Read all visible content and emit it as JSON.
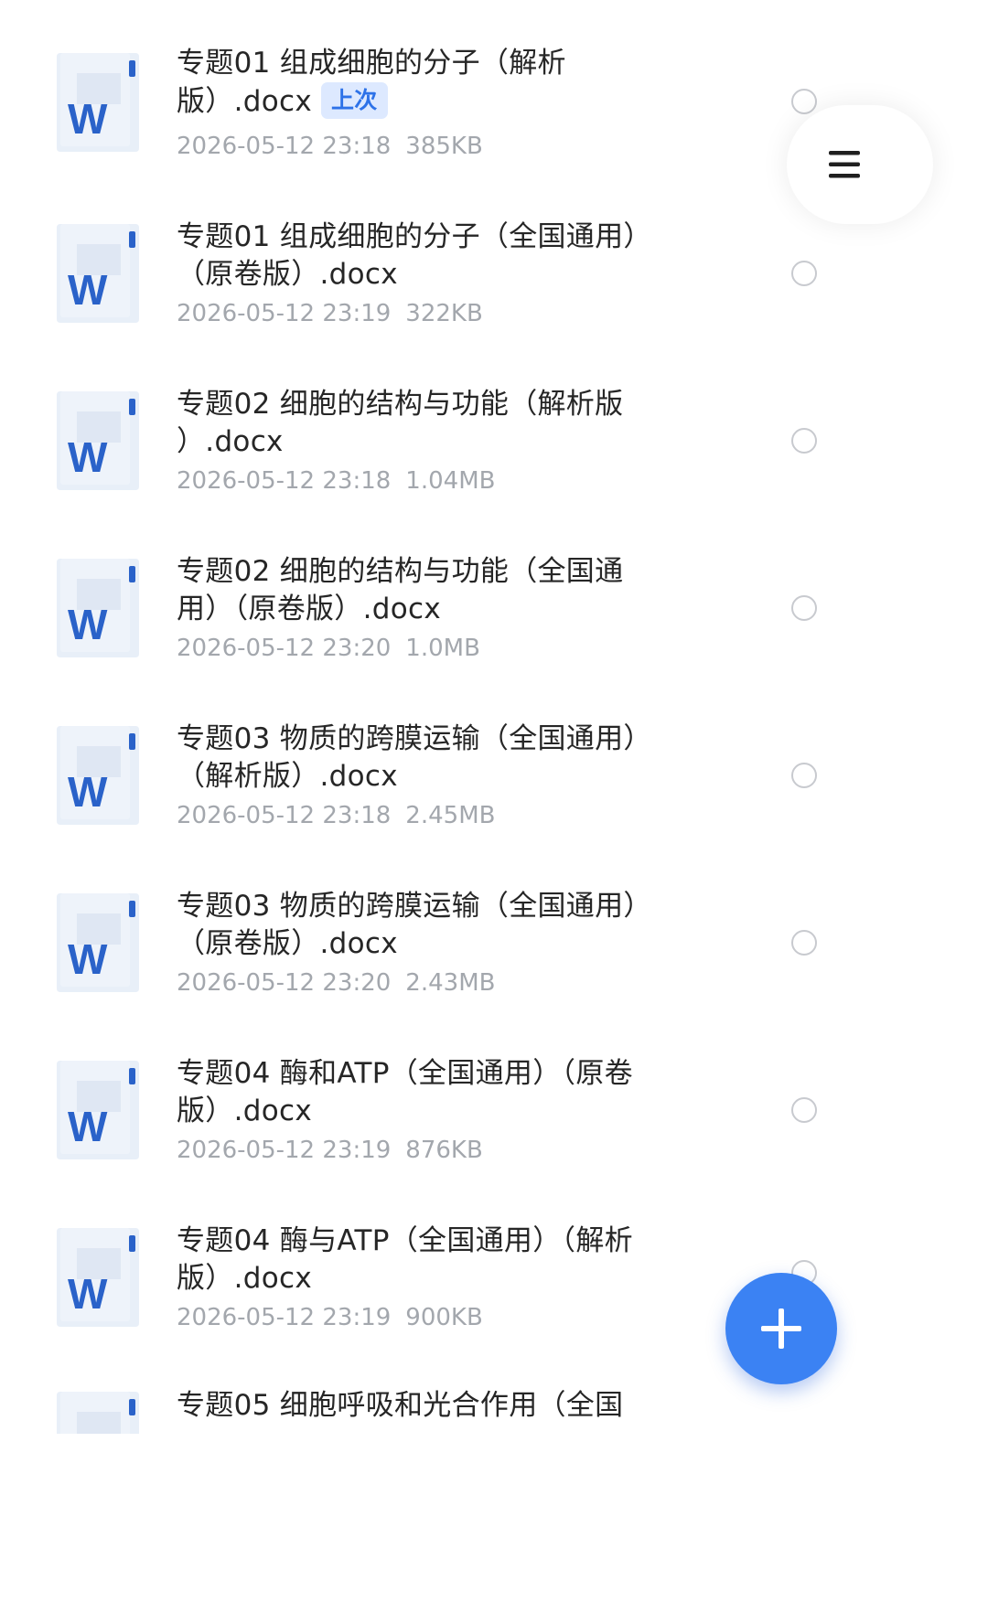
{
  "files": [
    {
      "title_line1": "专题01 组成细胞的分子（解析",
      "title_line2": "版）.docx",
      "badge": "上次",
      "date": "2026-05-12 23:18",
      "size": "385KB",
      "icon": "word-doc-icon"
    },
    {
      "title_line1": "专题01 组成细胞的分子（全国通用）",
      "title_line2": "（原卷版）.docx",
      "date": "2026-05-12 23:19",
      "size": "322KB",
      "icon": "word-doc-icon"
    },
    {
      "title_line1": "专题02 细胞的结构与功能（解析版",
      "title_line2": "）.docx",
      "date": "2026-05-12 23:18",
      "size": "1.04MB",
      "icon": "word-doc-icon"
    },
    {
      "title_line1": "专题02 细胞的结构与功能（全国通",
      "title_line2": "用）（原卷版）.docx",
      "date": "2026-05-12 23:20",
      "size": "1.0MB",
      "icon": "word-doc-icon"
    },
    {
      "title_line1": "专题03 物质的跨膜运输（全国通用）",
      "title_line2": "（解析版）.docx",
      "date": "2026-05-12 23:18",
      "size": "2.45MB",
      "icon": "word-doc-icon"
    },
    {
      "title_line1": "专题03 物质的跨膜运输（全国通用）",
      "title_line2": "（原卷版）.docx",
      "date": "2026-05-12 23:20",
      "size": "2.43MB",
      "icon": "word-doc-icon"
    },
    {
      "title_line1": "专题04 酶和ATP（全国通用）（原卷",
      "title_line2": "版）.docx",
      "date": "2026-05-12 23:19",
      "size": "876KB",
      "icon": "word-doc-icon"
    },
    {
      "title_line1": "专题04 酶与ATP（全国通用）（解析",
      "title_line2": "版）.docx",
      "date": "2026-05-12 23:19",
      "size": "900KB",
      "icon": "word-doc-icon"
    },
    {
      "title_line1": "专题05 细胞呼吸和光合作用（全国",
      "icon": "word-doc-icon"
    }
  ],
  "colors": {
    "accent": "#3b82f3",
    "word_blue": "#2a62c9",
    "badge_bg": "#dde9ff",
    "meta_text": "#a3a7ad",
    "title_text": "#262626"
  },
  "icons": {
    "side_menu": "hamburger-menu-icon",
    "fab": "plus-icon",
    "selector": "radio-circle-icon"
  }
}
